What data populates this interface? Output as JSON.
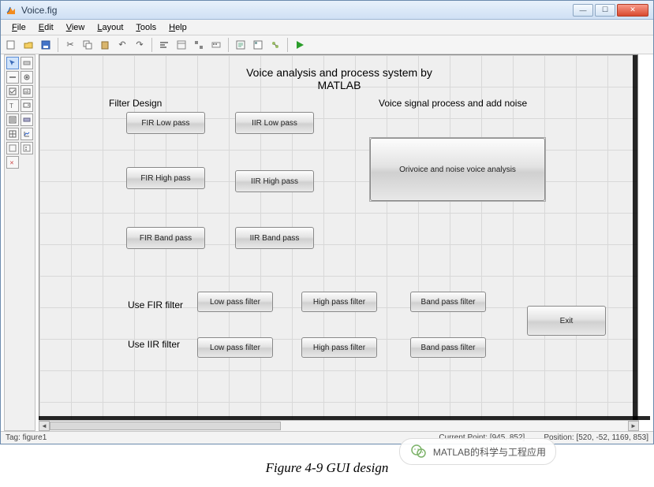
{
  "window": {
    "title": "Voice.fig"
  },
  "menus": {
    "file": "File",
    "edit": "Edit",
    "view": "View",
    "layout": "Layout",
    "tools": "Tools",
    "help": "Help"
  },
  "canvas": {
    "title1": "Voice analysis and process system by",
    "title2": "MATLAB",
    "sec_filter": "Filter Design",
    "sec_noise": "Voice signal process and add noise",
    "fir_low": "FIR Low pass",
    "iir_low": "IIR Low pass",
    "fir_high": "FIR High pass",
    "iir_high": "IIR High pass",
    "fir_band": "FIR Band pass",
    "iir_band": "IIR Band pass",
    "orivoice": "Orivoice and noise voice analysis",
    "use_fir": "Use FIR filter",
    "use_iir": "Use IIR filter",
    "fir_lp": "Low pass filter",
    "fir_hp": "High pass filter",
    "fir_bp": "Band pass filter",
    "iir_lp": "Low pass filter",
    "iir_hp": "High pass filter",
    "iir_bp": "Band pass filter",
    "exit": "Exit"
  },
  "status": {
    "tag": "Tag: figure1",
    "curpoint": "Current Point: [945, 852]",
    "position": "Position: [520, -52, 1169, 853]"
  },
  "caption": "Figure 4-9 GUI design",
  "channel": "MATLAB的科学与工程应用"
}
